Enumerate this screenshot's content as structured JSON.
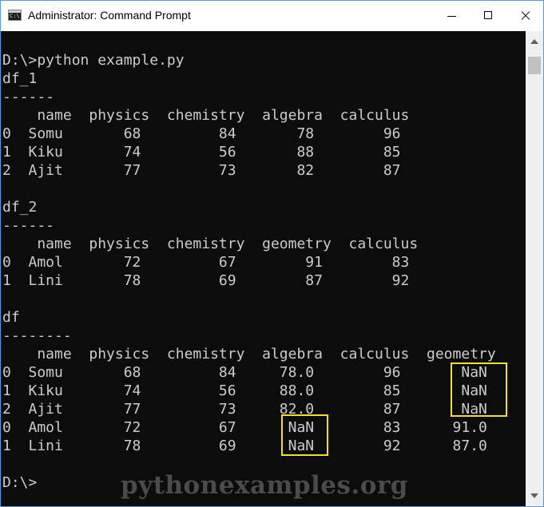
{
  "window": {
    "title": "Administrator: Command Prompt",
    "icon_text": "C:\\"
  },
  "console": {
    "text": "D:\\>python example.py\ndf_1\n------\n    name  physics  chemistry  algebra  calculus\n0  Somu       68         84       78        96\n1  Kiku       74         56       88        85\n2  Ajit       77         73       82        87\n\ndf_2\n------\n    name  physics  chemistry  geometry  calculus\n0  Amol       72         67        91        83\n1  Lini       78         69        87        92\n\ndf\n--------\n    name  physics  chemistry  algebra  calculus  geometry\n0  Somu       68         84     78.0        96       NaN\n1  Kiku       74         56     88.0        85       NaN\n2  Ajit       77         73     82.0        87       NaN\n0  Amol       72         67      NaN        83      91.0\n1  Lini       78         69      NaN        92      87.0\n\nD:\\>"
  },
  "highlight_color": "#f4e02a",
  "watermark": "pythonexamples.org"
}
